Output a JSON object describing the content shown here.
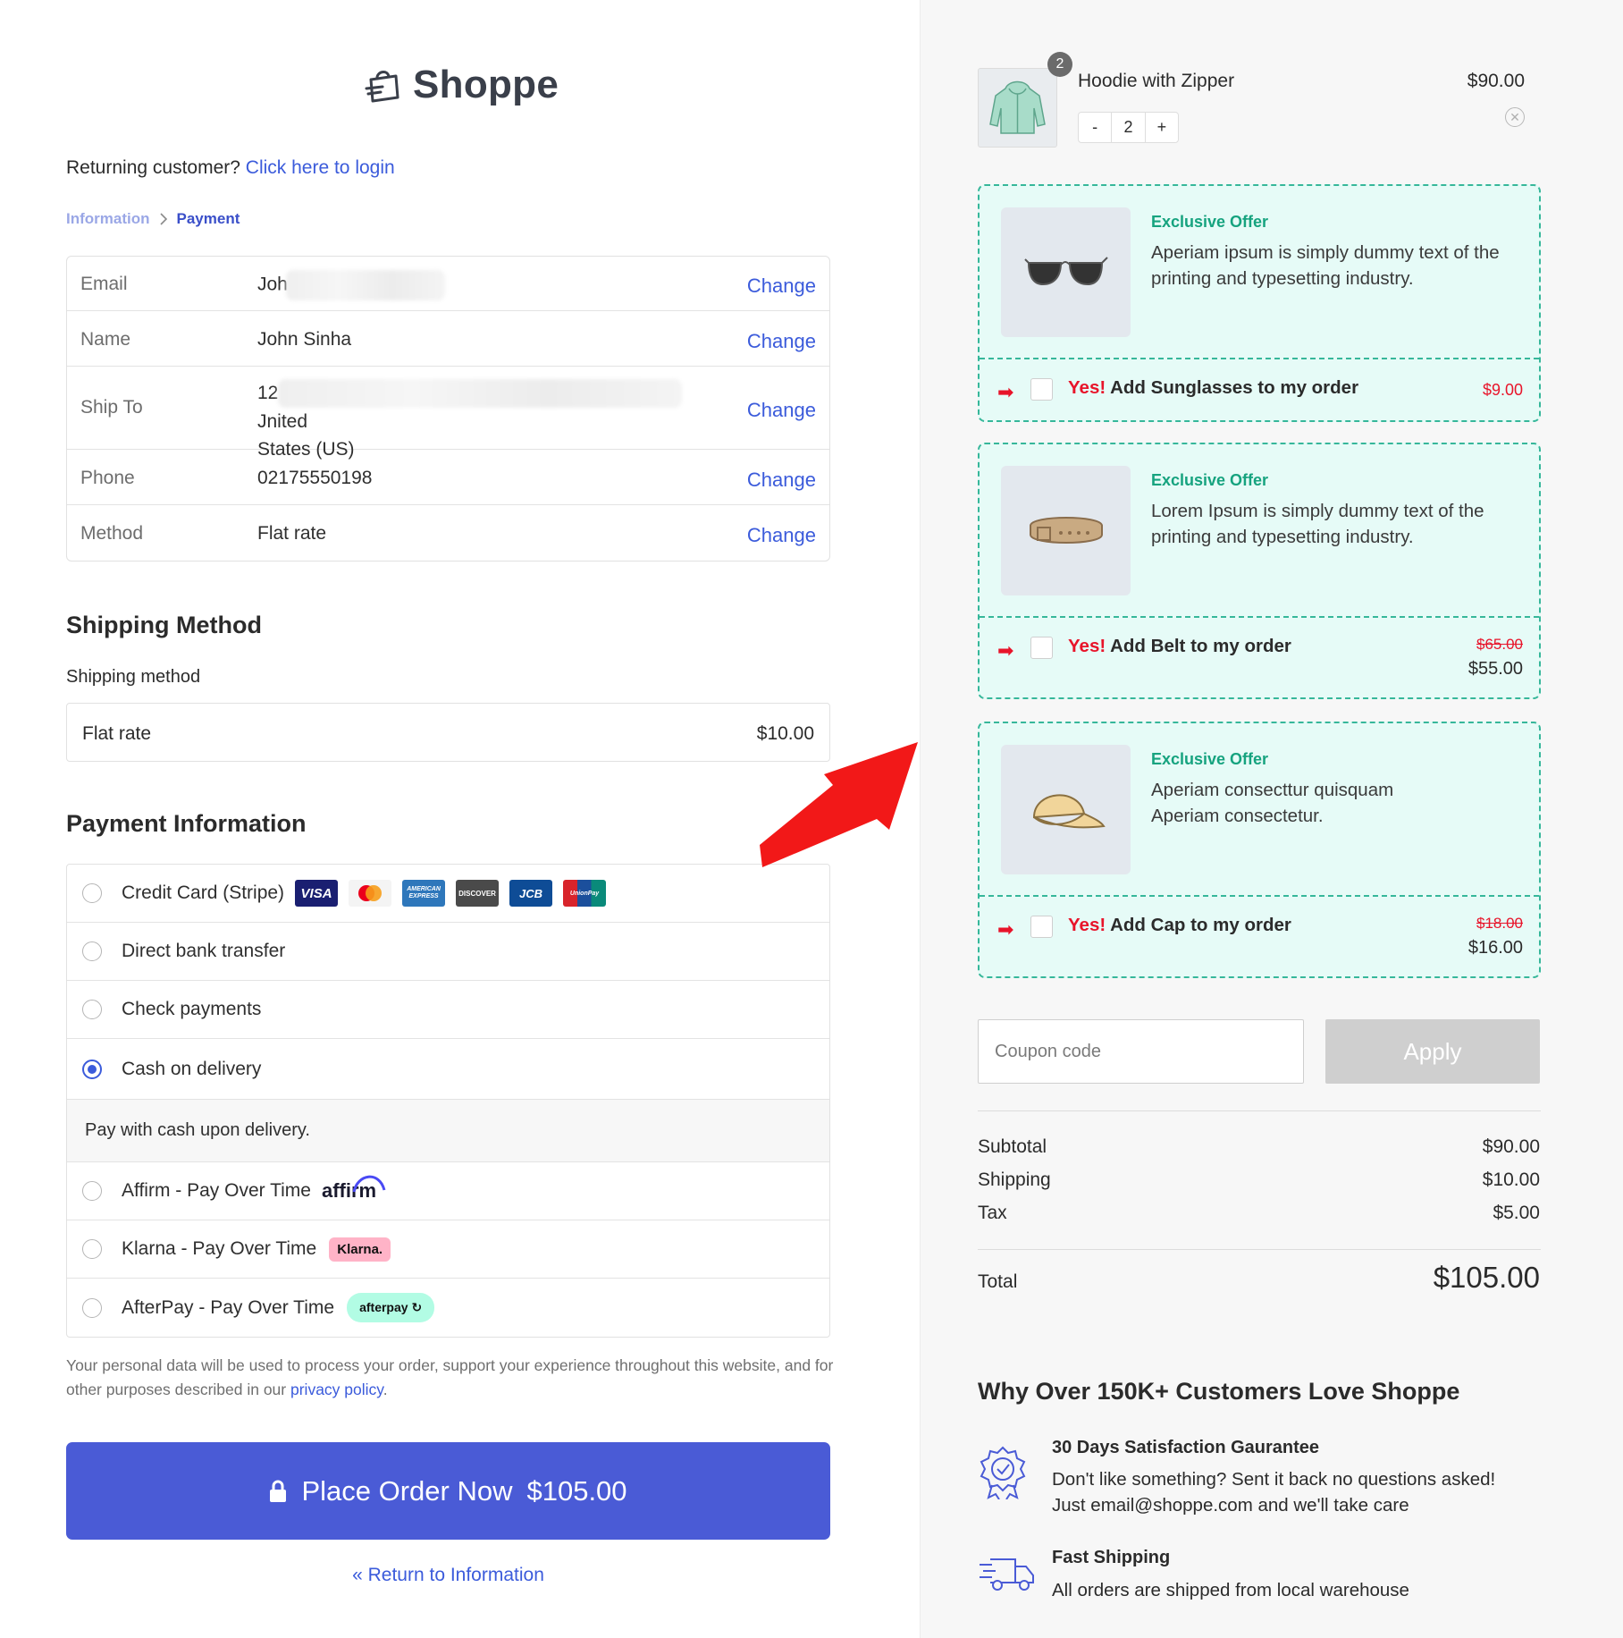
{
  "brand": {
    "name": "Shoppe"
  },
  "returning": {
    "text": "Returning customer?",
    "link": "Click here to login"
  },
  "breadcrumb": {
    "step1": "Information",
    "step2": "Payment"
  },
  "info_table": {
    "change_label": "Change",
    "rows": [
      {
        "label": "Email",
        "value": "Joh"
      },
      {
        "label": "Name",
        "value": "John Sinha"
      },
      {
        "label": "Ship To",
        "value_line1_start": "12",
        "value_line1_end": "Jnited",
        "value_line2": "States (US)"
      },
      {
        "label": "Phone",
        "value": "02175550198"
      },
      {
        "label": "Method",
        "value": "Flat rate"
      }
    ]
  },
  "shipping": {
    "title": "Shipping Method",
    "label": "Shipping method",
    "option": "Flat rate",
    "price": "$10.00"
  },
  "payment": {
    "title": "Payment Information",
    "methods": [
      {
        "label": "Credit Card (Stripe)",
        "selected": false
      },
      {
        "label": "Direct bank transfer",
        "selected": false
      },
      {
        "label": "Check payments",
        "selected": false
      },
      {
        "label": "Cash on delivery",
        "selected": true
      },
      {
        "label": "Affirm - Pay Over Time",
        "selected": false
      },
      {
        "label": "Klarna - Pay Over Time",
        "selected": false
      },
      {
        "label": "AfterPay - Pay Over Time",
        "selected": false
      }
    ],
    "cod_description": "Pay with cash upon delivery.",
    "cards": [
      "VISA",
      "mastercard",
      "AMERICAN EXPRESS",
      "DISCOVER",
      "JCB",
      "UnionPay"
    ],
    "affirm_logo": "affirm",
    "klarna_logo": "Klarna.",
    "afterpay_logo": "afterpay"
  },
  "privacy": {
    "text": "Your personal data will be used to process your order, support your experience throughout this website, and for other purposes described in our",
    "link": "privacy policy",
    "end": "."
  },
  "place_order": {
    "label": "Place Order Now",
    "amount": "$105.00"
  },
  "return_link": "« Return to Information",
  "cart": {
    "item": {
      "name": "Hoodie with Zipper",
      "price": "$90.00",
      "badge": "2",
      "qty": "2",
      "minus": "-",
      "plus": "+"
    }
  },
  "offers": [
    {
      "tag": "Exclusive Offer",
      "text": "Aperiam ipsum is simply dummy text of the printing and typesetting industry.",
      "yes": "Yes!",
      "cta": "Add Sunglasses to my order",
      "price": "$9.00",
      "icon": "sunglasses-icon"
    },
    {
      "tag": "Exclusive Offer",
      "text": "Lorem Ipsum is simply dummy text of the printing and typesetting industry.",
      "yes": "Yes!",
      "cta": "Add Belt to my order",
      "old_price": "$65.00",
      "price": "$55.00",
      "icon": "belt-icon"
    },
    {
      "tag": "Exclusive Offer",
      "text": "Aperiam consecttur quisquam Aperiam consectetur.",
      "yes": "Yes!",
      "cta": "Add Cap to my order",
      "old_price": "$18.00",
      "price": "$16.00",
      "icon": "cap-icon"
    }
  ],
  "coupon": {
    "placeholder": "Coupon code",
    "apply": "Apply"
  },
  "summary": {
    "subtotal_label": "Subtotal",
    "subtotal": "$90.00",
    "shipping_label": "Shipping",
    "shipping": "$10.00",
    "tax_label": "Tax",
    "tax": "$5.00",
    "total_label": "Total",
    "total": "$105.00"
  },
  "why": {
    "title": "Why Over 150K+ Customers Love Shoppe",
    "features": [
      {
        "title": "30 Days Satisfaction Gaurantee",
        "line1": "Don't like something? Sent it back no questions asked!",
        "line2": "Just email@shoppe.com and we'll take care",
        "icon": "badge-check-icon"
      },
      {
        "title": "Fast Shipping",
        "line1": "All orders are shipped from local warehouse",
        "icon": "truck-icon"
      }
    ]
  },
  "colors": {
    "accent": "#4a5bd6",
    "link": "#3b5bdb",
    "offer_border": "#36b79a",
    "offer_bg": "#e6fbf7",
    "offer_red": "#e8142a",
    "arrow": "#f21818"
  }
}
